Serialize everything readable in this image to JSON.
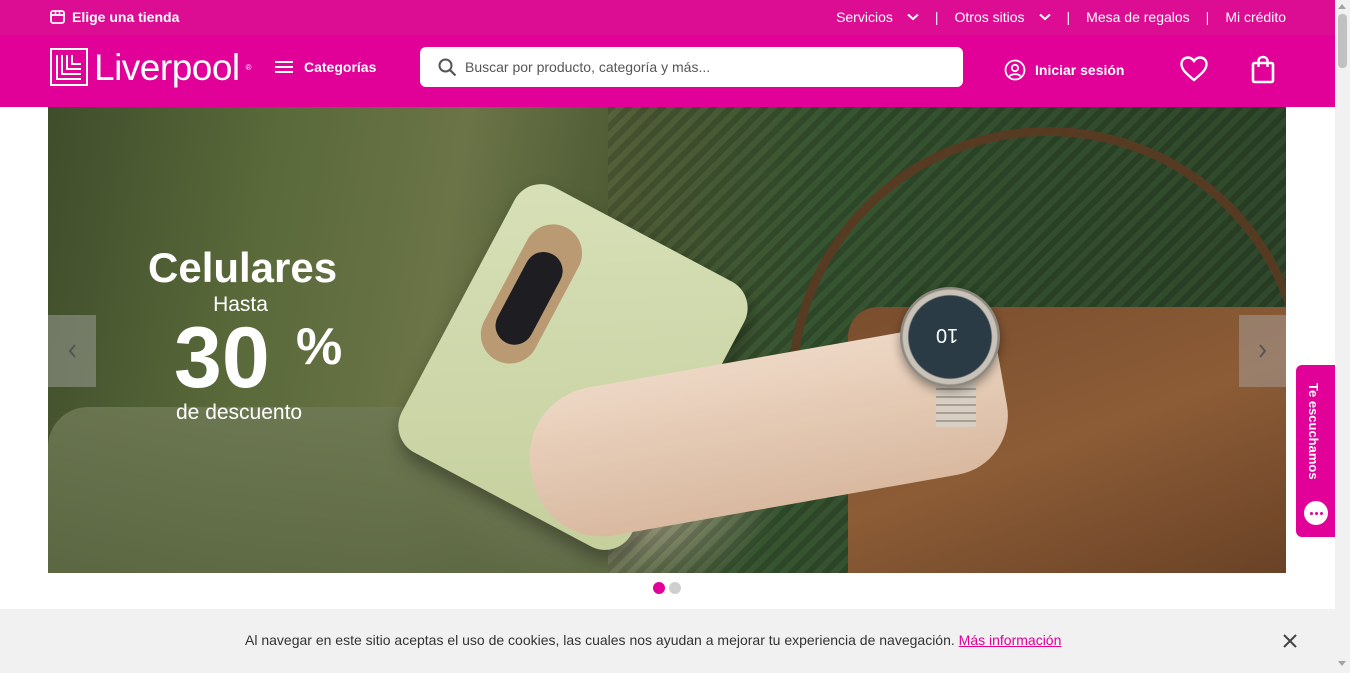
{
  "topbar": {
    "store_label": "Elige una tienda",
    "store_icon": "store-icon",
    "links": [
      {
        "label": "Servicios",
        "dropdown": true
      },
      {
        "label": "Otros sitios",
        "dropdown": true
      },
      {
        "label": "Mesa de regalos",
        "dropdown": false
      },
      {
        "label": "Mi crédito",
        "dropdown": false
      }
    ],
    "separator": "|"
  },
  "header": {
    "logo_text": "Liverpool",
    "logo_mark": "®",
    "categories_label": "Categorías",
    "search_placeholder": "Buscar por producto, categoría y más...",
    "login_label": "Iniciar sesión",
    "icons": [
      "menu-icon",
      "search-icon",
      "user-icon",
      "heart-icon",
      "shopping-bag-icon"
    ]
  },
  "hero": {
    "title": "Celulares",
    "subtitle": "Hasta",
    "amount": "30",
    "percent": "%",
    "caption": "de descuento",
    "slides_total": 2,
    "active_slide": 1
  },
  "feedback": {
    "label": "Te escuchamos"
  },
  "cookie": {
    "message": "Al navegar en este sitio aceptas el uso de cookies, las cuales nos ayudan a mejorar tu experiencia de navegación.",
    "link_label": "Más información"
  },
  "colors": {
    "brand_pink": "#e10098",
    "topbar_pink": "#dc0d92",
    "cookie_bg": "#f1f1f1"
  }
}
